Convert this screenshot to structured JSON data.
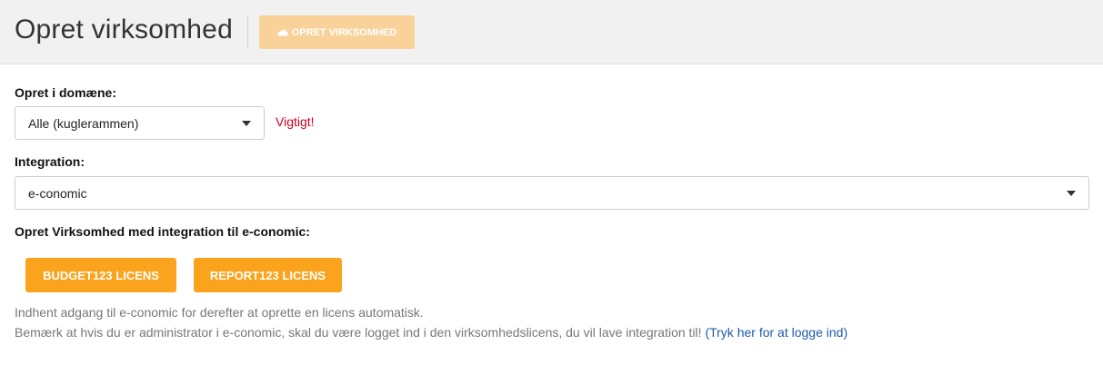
{
  "header": {
    "title": "Opret virksomhed",
    "create_button_label": "OPRET VIRKSOMHED",
    "create_button_icon": "cloud-icon"
  },
  "domain": {
    "label": "Opret i domæne:",
    "selected": "Alle (kuglerammen)",
    "warning": "Vigtigt!"
  },
  "integration": {
    "label": "Integration:",
    "selected": "e-conomic"
  },
  "section": {
    "title": "Opret Virksomhed med integration til e-conomic:",
    "buttons": [
      {
        "label": "BUDGET123 LICENS"
      },
      {
        "label": "REPORT123 LICENS"
      }
    ]
  },
  "help": {
    "line1": "Indhent adgang til e-conomic for derefter at oprette en licens automatisk.",
    "line2": "Bemærk at hvis du er administrator i e-conomic, skal du være logget ind i den virksomhedslicens, du vil lave integration til!",
    "login_link": "(Tryk her for at logge ind)"
  },
  "colors": {
    "accent": "#fba31c",
    "accent_disabled": "#f9d29a",
    "warning": "#d0021b",
    "link": "#1e5aa8"
  }
}
